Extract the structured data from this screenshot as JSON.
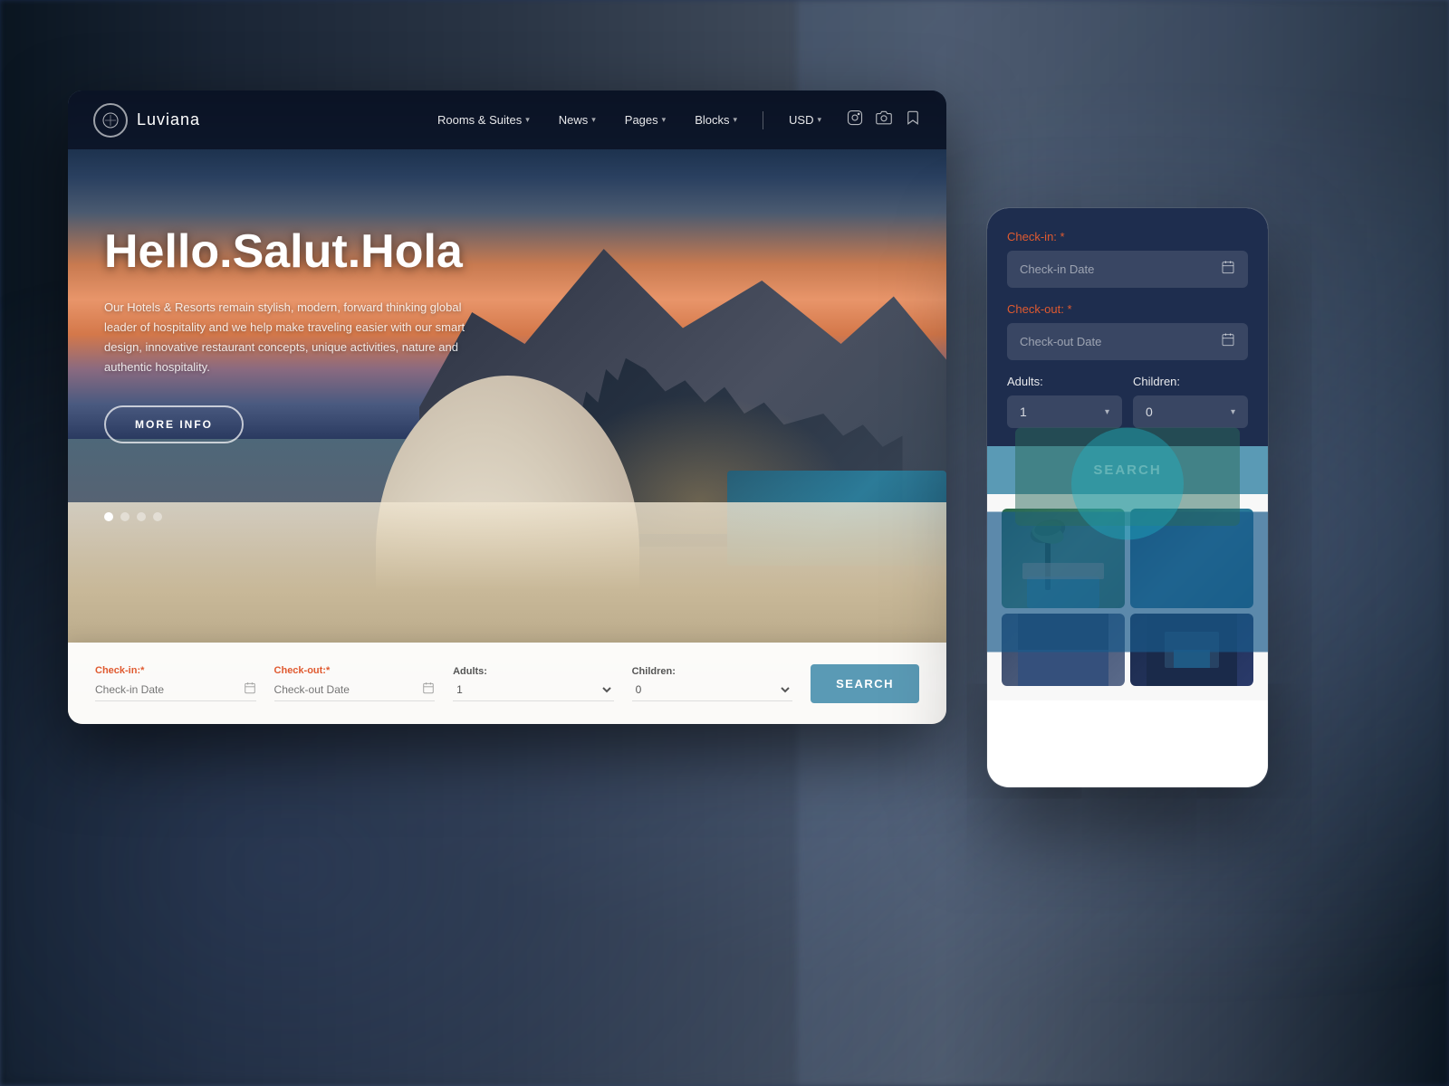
{
  "background": {
    "color": "#1a2540"
  },
  "navbar": {
    "logo_text": "Luviana",
    "logo_icon": "✦",
    "menu_items": [
      {
        "label": "Rooms & Suites",
        "has_dropdown": true
      },
      {
        "label": "News",
        "has_dropdown": true
      },
      {
        "label": "Pages",
        "has_dropdown": true
      },
      {
        "label": "Blocks",
        "has_dropdown": true
      },
      {
        "label": "USD",
        "has_dropdown": true
      }
    ],
    "social_icons": [
      "instagram",
      "camera",
      "flag"
    ]
  },
  "hero": {
    "title": "Hello.Salut.Hola",
    "description": "Our Hotels & Resorts remain stylish, modern, forward thinking global leader of hospitality and we help make traveling easier with our smart design, innovative restaurant concepts, unique activities, nature and authentic hospitality.",
    "cta_label": "MORE INFO",
    "dots_count": 4,
    "active_dot": 0
  },
  "booking_bar": {
    "checkin_label": "Check-in:",
    "checkin_required": "*",
    "checkin_placeholder": "Check-in Date",
    "checkout_label": "Check-out:",
    "checkout_required": "*",
    "checkout_placeholder": "Check-out Date",
    "adults_label": "Adults:",
    "adults_value": "1",
    "children_label": "Children:",
    "children_value": "0",
    "search_label": "SEARCH"
  },
  "mobile": {
    "checkin_label": "Check-in:",
    "checkin_required": "*",
    "checkin_placeholder": "Check-in Date",
    "checkout_label": "Check-out:",
    "checkout_required": "*",
    "checkout_placeholder": "Check-out Date",
    "adults_label": "Adults:",
    "adults_value": "1",
    "children_label": "Children:",
    "children_value": "0",
    "search_label": "SEARCH"
  }
}
